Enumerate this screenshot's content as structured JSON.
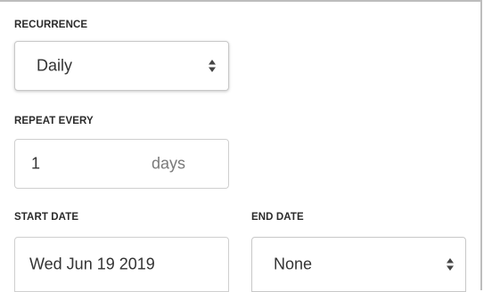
{
  "recurrence": {
    "label": "RECURRENCE",
    "selected": "Daily"
  },
  "repeat_every": {
    "label": "REPEAT EVERY",
    "value": "1",
    "unit": "days"
  },
  "start_date": {
    "label": "START DATE",
    "value": "Wed Jun 19 2019"
  },
  "end_date": {
    "label": "END DATE",
    "selected": "None"
  },
  "icons": {
    "select_arrows": "up-down-caret-icon"
  },
  "colors": {
    "border": "#cfcfcf",
    "label_text": "#2b2b2b",
    "value_text": "#333333",
    "unit_text": "#7a7a7a"
  }
}
